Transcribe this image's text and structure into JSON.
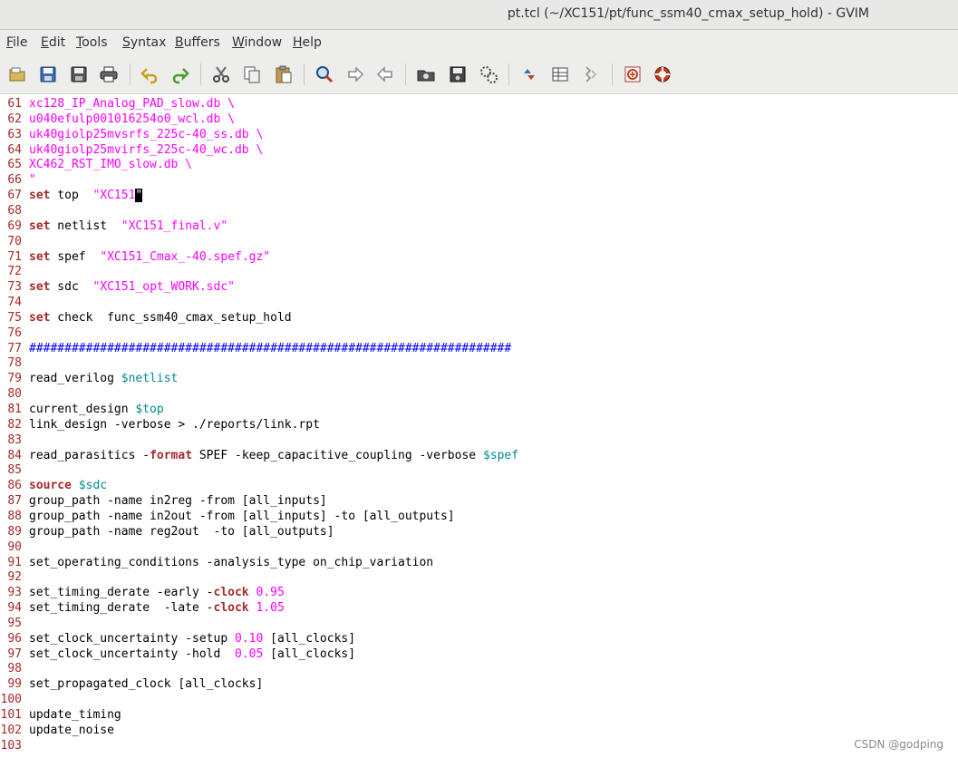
{
  "window": {
    "title": "pt.tcl (~/XC151/pt/func_ssm40_cmax_setup_hold) - GVIM"
  },
  "menu": [
    {
      "mn": "F",
      "rest": "ile"
    },
    {
      "mn": "E",
      "rest": "dit"
    },
    {
      "mn": "T",
      "rest": "ools"
    },
    {
      "mn": "S",
      "rest": "yntax"
    },
    {
      "mn": "B",
      "rest": "uffers"
    },
    {
      "mn": "W",
      "rest": "indow"
    },
    {
      "mn": "H",
      "rest": "elp"
    }
  ],
  "toolbar": {
    "icons": [
      "open-file-icon",
      "save-icon",
      "save-all-icon",
      "print-icon",
      "undo-icon",
      "redo-icon",
      "cut-icon",
      "copy-icon",
      "paste-icon",
      "find-replace-icon",
      "find-next-icon",
      "find-previous-icon",
      "load-session-icon",
      "save-session-icon",
      "run-script-icon",
      "make-icon",
      "shell-icon",
      "tags-jump-icon",
      "help-icon",
      "find-help-icon"
    ]
  },
  "editor": {
    "lines": [
      {
        "n": "61",
        "tokens": [
          {
            "t": "xc128_IP_Analog_PAD_slow.db \\",
            "c": "str"
          }
        ]
      },
      {
        "n": "62",
        "tokens": [
          {
            "t": "u040efulp001016254o0_wcl.db \\",
            "c": "str"
          }
        ]
      },
      {
        "n": "63",
        "tokens": [
          {
            "t": "uk40giolp25mvsrfs_225c-40_ss.db \\",
            "c": "str"
          }
        ]
      },
      {
        "n": "64",
        "tokens": [
          {
            "t": "uk40giolp25mvirfs_225c-40_wc.db \\",
            "c": "str"
          }
        ]
      },
      {
        "n": "65",
        "tokens": [
          {
            "t": "XC462_RST_IMO_slow.db \\",
            "c": "str"
          }
        ]
      },
      {
        "n": "66",
        "tokens": [
          {
            "t": "\"",
            "c": "str"
          }
        ]
      },
      {
        "n": "67",
        "tokens": [
          {
            "t": "set",
            "c": "kw"
          },
          {
            "t": " top  ",
            "c": "plain"
          },
          {
            "t": "\"XC151",
            "c": "str"
          },
          {
            "t": "\"",
            "c": "cursor"
          }
        ]
      },
      {
        "n": "68",
        "tokens": []
      },
      {
        "n": "69",
        "tokens": [
          {
            "t": "set",
            "c": "kw"
          },
          {
            "t": " netlist  ",
            "c": "plain"
          },
          {
            "t": "\"XC151_final.v\"",
            "c": "str"
          }
        ]
      },
      {
        "n": "70",
        "tokens": []
      },
      {
        "n": "71",
        "tokens": [
          {
            "t": "set",
            "c": "kw"
          },
          {
            "t": " spef  ",
            "c": "plain"
          },
          {
            "t": "\"XC151_Cmax_-40.spef.gz\"",
            "c": "str"
          }
        ]
      },
      {
        "n": "72",
        "tokens": []
      },
      {
        "n": "73",
        "tokens": [
          {
            "t": "set",
            "c": "kw"
          },
          {
            "t": " sdc  ",
            "c": "plain"
          },
          {
            "t": "\"XC151_opt_WORK.sdc\"",
            "c": "str"
          }
        ]
      },
      {
        "n": "74",
        "tokens": []
      },
      {
        "n": "75",
        "tokens": [
          {
            "t": "set",
            "c": "kw"
          },
          {
            "t": " check  func_ssm40_cmax_setup_hold",
            "c": "plain"
          }
        ]
      },
      {
        "n": "76",
        "tokens": []
      },
      {
        "n": "77",
        "tokens": [
          {
            "t": "####################################################################",
            "c": "comment"
          }
        ]
      },
      {
        "n": "78",
        "tokens": []
      },
      {
        "n": "79",
        "tokens": [
          {
            "t": "read_verilog ",
            "c": "plain"
          },
          {
            "t": "$netlist",
            "c": "var"
          }
        ]
      },
      {
        "n": "80",
        "tokens": []
      },
      {
        "n": "81",
        "tokens": [
          {
            "t": "current_design ",
            "c": "plain"
          },
          {
            "t": "$top",
            "c": "var"
          }
        ]
      },
      {
        "n": "82",
        "tokens": [
          {
            "t": "link_design -verbose > ./reports/link.rpt",
            "c": "plain"
          }
        ]
      },
      {
        "n": "83",
        "tokens": []
      },
      {
        "n": "84",
        "tokens": [
          {
            "t": "read_parasitics -",
            "c": "plain"
          },
          {
            "t": "format",
            "c": "kw"
          },
          {
            "t": " SPEF -keep_capacitive_coupling -verbose ",
            "c": "plain"
          },
          {
            "t": "$spef",
            "c": "var"
          }
        ]
      },
      {
        "n": "85",
        "tokens": []
      },
      {
        "n": "86",
        "tokens": [
          {
            "t": "source",
            "c": "kw"
          },
          {
            "t": " ",
            "c": "plain"
          },
          {
            "t": "$sdc",
            "c": "var"
          }
        ]
      },
      {
        "n": "87",
        "tokens": [
          {
            "t": "group_path -name in2reg -from [all_inputs]",
            "c": "plain"
          }
        ]
      },
      {
        "n": "88",
        "tokens": [
          {
            "t": "group_path -name in2out -from [all_inputs] -to [all_outputs]",
            "c": "plain"
          }
        ]
      },
      {
        "n": "89",
        "tokens": [
          {
            "t": "group_path -name reg2out  -to [all_outputs]",
            "c": "plain"
          }
        ]
      },
      {
        "n": "90",
        "tokens": []
      },
      {
        "n": "91",
        "tokens": [
          {
            "t": "set_operating_conditions -analysis_type on_chip_variation",
            "c": "plain"
          }
        ]
      },
      {
        "n": "92",
        "tokens": []
      },
      {
        "n": "93",
        "tokens": [
          {
            "t": "set_timing_derate -early -",
            "c": "plain"
          },
          {
            "t": "clock",
            "c": "kw"
          },
          {
            "t": " ",
            "c": "plain"
          },
          {
            "t": "0.95",
            "c": "num"
          }
        ]
      },
      {
        "n": "94",
        "tokens": [
          {
            "t": "set_timing_derate  -late -",
            "c": "plain"
          },
          {
            "t": "clock",
            "c": "kw"
          },
          {
            "t": " ",
            "c": "plain"
          },
          {
            "t": "1.05",
            "c": "num"
          }
        ]
      },
      {
        "n": "95",
        "tokens": []
      },
      {
        "n": "96",
        "tokens": [
          {
            "t": "set_clock_uncertainty -setup ",
            "c": "plain"
          },
          {
            "t": "0.10",
            "c": "num"
          },
          {
            "t": " [all_clocks]",
            "c": "plain"
          }
        ]
      },
      {
        "n": "97",
        "tokens": [
          {
            "t": "set_clock_uncertainty -hold  ",
            "c": "plain"
          },
          {
            "t": "0.05",
            "c": "num"
          },
          {
            "t": " [all_clocks]",
            "c": "plain"
          }
        ]
      },
      {
        "n": "98",
        "tokens": []
      },
      {
        "n": "99",
        "tokens": [
          {
            "t": "set_propagated_clock [all_clocks]",
            "c": "plain"
          }
        ]
      },
      {
        "n": "100",
        "tokens": []
      },
      {
        "n": "101",
        "tokens": [
          {
            "t": "update_timing",
            "c": "plain"
          }
        ]
      },
      {
        "n": "102",
        "tokens": [
          {
            "t": "update_noise",
            "c": "plain"
          }
        ]
      },
      {
        "n": "103",
        "tokens": []
      }
    ]
  },
  "watermark": "CSDN @godping"
}
